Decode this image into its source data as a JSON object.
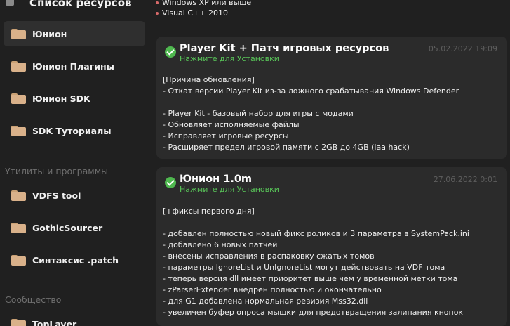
{
  "sidebar": {
    "title": "Список ресурсов",
    "items": [
      {
        "label": "Юнион",
        "active": true
      },
      {
        "label": "Юнион Плагины",
        "active": false
      },
      {
        "label": "Юнион SDK",
        "active": false
      },
      {
        "label": "SDK Туториалы",
        "active": false
      }
    ],
    "section_tools": "Утилиты и программы",
    "tools": [
      {
        "label": "VDFS tool"
      },
      {
        "label": "GothicSourcer"
      },
      {
        "label": "Синтаксис .patch"
      }
    ],
    "section_community": "Сообщество",
    "community": [
      {
        "label": "TopLayer"
      }
    ]
  },
  "main": {
    "requirements": [
      "Windows XP или выше",
      "Visual C++ 2010"
    ],
    "cards": [
      {
        "title": "Player Kit + Патч игровых ресурсов",
        "install": "Нажмите для Установки",
        "date": "05.02.2022 19:09",
        "lines": [
          "[Причина обновления]",
          "- Откат версии Player Kit из-за ложного срабатывания Windows Defender",
          "",
          "- Player Kit - базовый набор для игры с модами",
          "- Обновляет исполняемые файлы",
          "- Исправляет игровые ресурсы",
          "- Расширяет предел игровой памяти с 2GB до 4GB (laa hack)"
        ]
      },
      {
        "title": "Юнион 1.0m",
        "install": "Нажмите для Установки",
        "date": "27.06.2022 0:01",
        "lines": [
          "[+фиксы первого дня]",
          "",
          "- добавлен полностью новый фикс роликов и 3 параметра в SystemPack.ini",
          "- добавлено 6 новых патчей",
          "- внесены исправления в распаковку сжатых томов",
          "- параметры IgnoreList и UnIgnoreList могут действовать на VDF тома",
          "- теперь версия dll имеет приоритет выше чем у временной метки тома",
          "- zParserExtender внедрен полностью и окончательно",
          "- для G1 добавлена нормальная ревизия Mss32.dll",
          "- увеличен буфер опроса мышки для предотвращения залипания кнопок"
        ]
      }
    ]
  },
  "colors": {
    "background": "#202020",
    "card": "#2b2b2b",
    "active_item": "#2f2f2f",
    "accent_green": "#58c458",
    "folder": "#d9b18a",
    "muted": "#6e6e6e"
  }
}
